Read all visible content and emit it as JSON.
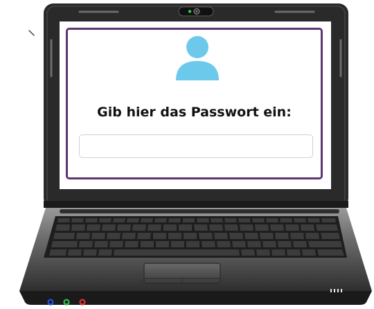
{
  "dialog": {
    "prompt": "Gib hier das Passwort ein:",
    "password_value": "",
    "password_placeholder": "",
    "icon": "user-icon"
  },
  "laptop": {
    "webcam_icon": "webcam-icon",
    "port_colors": [
      "#1f4fd6",
      "#2fb24a",
      "#d63030"
    ]
  },
  "colors": {
    "dialog_border": "#5e3470",
    "user_icon": "#6cc9ec",
    "laptop_body": "#2a2a2a"
  }
}
